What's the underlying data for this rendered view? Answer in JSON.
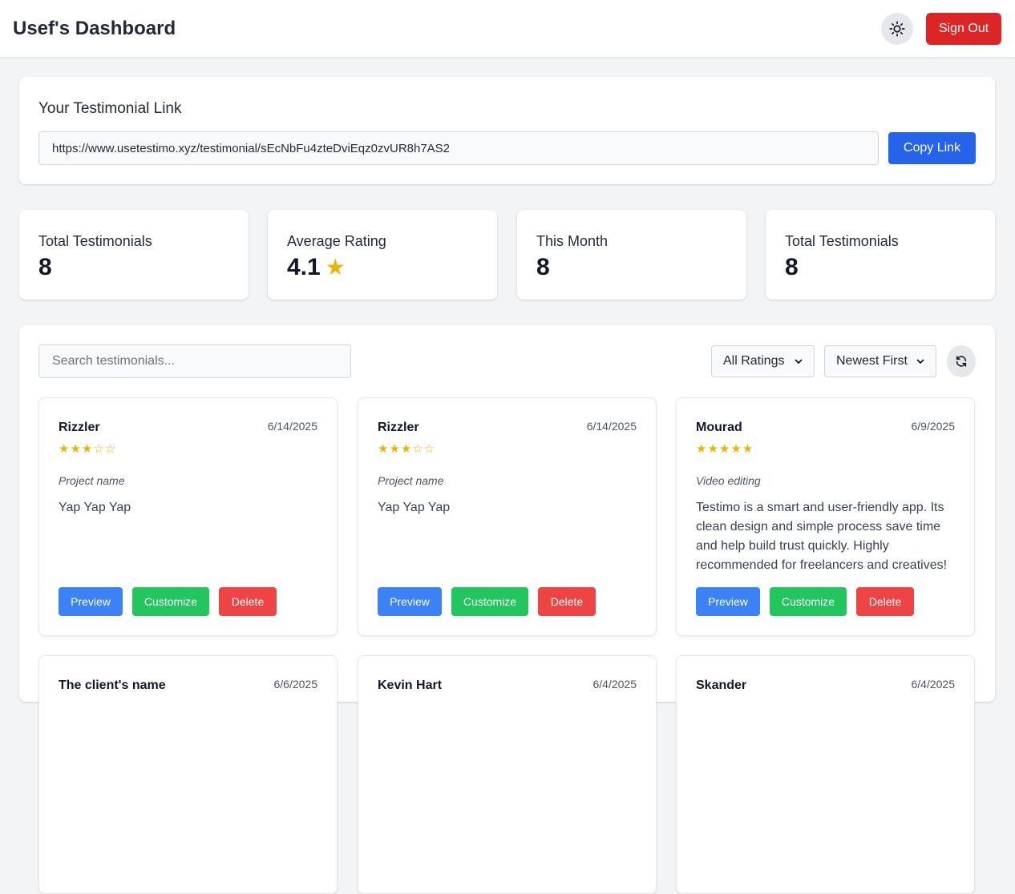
{
  "header": {
    "title": "Usef's Dashboard",
    "sign_out_label": "Sign Out"
  },
  "link_section": {
    "title": "Your Testimonial Link",
    "url": "https://www.usetestimo.xyz/testimonial/sEcNbFu4zteDviEqz0zvUR8h7AS2",
    "copy_label": "Copy Link"
  },
  "stats": [
    {
      "label": "Total Testimonials",
      "value": "8"
    },
    {
      "label": "Average Rating",
      "value": "4.1",
      "star": "★"
    },
    {
      "label": "This Month",
      "value": "8"
    },
    {
      "label": "Total Testimonials",
      "value": "8"
    }
  ],
  "filters": {
    "search_placeholder": "Search testimonials...",
    "ratings_selected": "All Ratings",
    "sort_selected": "Newest First"
  },
  "actions": {
    "preview": "Preview",
    "customize": "Customize",
    "delete": "Delete"
  },
  "colors": {
    "accent_blue": "#2563eb",
    "danger": "#dc2626",
    "star": "#eab308",
    "success": "#22c55e"
  },
  "testimonials": [
    {
      "name": "Rizzler",
      "date": "6/14/2025",
      "rating": 3,
      "stars": "★★★☆☆",
      "project": "Project name",
      "text": "Yap Yap Yap"
    },
    {
      "name": "Rizzler",
      "date": "6/14/2025",
      "rating": 3,
      "stars": "★★★☆☆",
      "project": "Project name",
      "text": "Yap Yap Yap"
    },
    {
      "name": "Mourad",
      "date": "6/9/2025",
      "rating": 5,
      "stars": "★★★★★",
      "project": "Video editing",
      "text": "Testimo is a smart and user-friendly app. Its clean design and simple process save time and help build trust quickly. Highly recommended for freelancers and creatives!"
    },
    {
      "name": "The client's name",
      "date": "6/6/2025"
    },
    {
      "name": "Kevin Hart",
      "date": "6/4/2025"
    },
    {
      "name": "Skander",
      "date": "6/4/2025"
    }
  ]
}
